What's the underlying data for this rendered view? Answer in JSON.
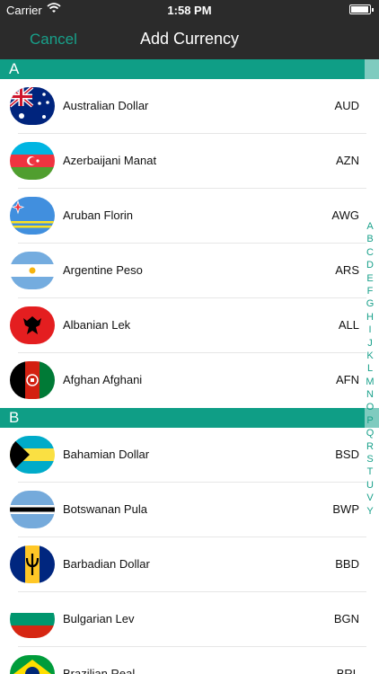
{
  "status": {
    "carrier": "Carrier",
    "time": "1:58 PM",
    "battery_level": 0.95
  },
  "nav": {
    "cancel": "Cancel",
    "title": "Add Currency"
  },
  "colors": {
    "accent": "#0f9e86",
    "nav_bg": "#2b2b2b"
  },
  "sections": [
    {
      "letter": "A",
      "rows": [
        {
          "name": "Australian Dollar",
          "code": "AUD",
          "flag": "australia-flag-icon"
        },
        {
          "name": "Azerbaijani Manat",
          "code": "AZN",
          "flag": "azerbaijan-flag-icon"
        },
        {
          "name": "Aruban Florin",
          "code": "AWG",
          "flag": "aruba-flag-icon"
        },
        {
          "name": "Argentine Peso",
          "code": "ARS",
          "flag": "argentina-flag-icon"
        },
        {
          "name": "Albanian Lek",
          "code": "ALL",
          "flag": "albania-flag-icon"
        },
        {
          "name": "Afghan Afghani",
          "code": "AFN",
          "flag": "afghanistan-flag-icon"
        }
      ]
    },
    {
      "letter": "B",
      "rows": [
        {
          "name": "Bahamian Dollar",
          "code": "BSD",
          "flag": "bahamas-flag-icon"
        },
        {
          "name": "Botswanan Pula",
          "code": "BWP",
          "flag": "botswana-flag-icon"
        },
        {
          "name": "Barbadian Dollar",
          "code": "BBD",
          "flag": "barbados-flag-icon"
        },
        {
          "name": "Bulgarian Lev",
          "code": "BGN",
          "flag": "bulgaria-flag-icon"
        },
        {
          "name": "Brazilian Real",
          "code": "BRL",
          "flag": "brazil-flag-icon"
        }
      ]
    }
  ],
  "index_letters": [
    "A",
    "B",
    "C",
    "D",
    "E",
    "F",
    "G",
    "H",
    "I",
    "J",
    "K",
    "L",
    "M",
    "N",
    "O",
    "P",
    "Q",
    "R",
    "S",
    "T",
    "U",
    "V",
    "Y"
  ]
}
